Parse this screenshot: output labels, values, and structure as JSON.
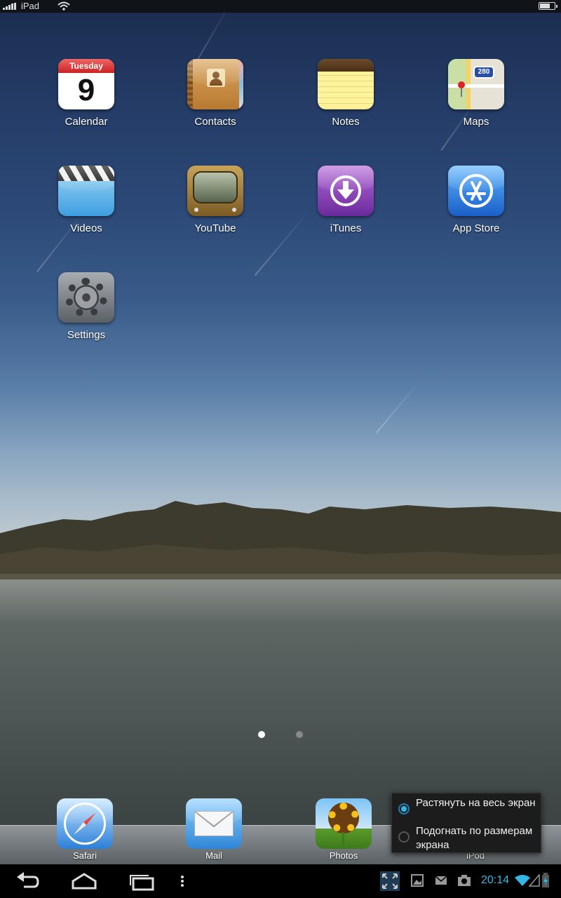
{
  "ipad_status": {
    "carrier": "iPad"
  },
  "apps": [
    {
      "label": "Calendar",
      "icon": "calendar-icon",
      "day_name": "Tuesday",
      "day_number": "9"
    },
    {
      "label": "Contacts",
      "icon": "contacts-icon"
    },
    {
      "label": "Notes",
      "icon": "notes-icon"
    },
    {
      "label": "Maps",
      "icon": "maps-icon",
      "route": "280"
    },
    {
      "label": "Videos",
      "icon": "videos-icon"
    },
    {
      "label": "YouTube",
      "icon": "youtube-icon"
    },
    {
      "label": "iTunes",
      "icon": "itunes-icon"
    },
    {
      "label": "App Store",
      "icon": "app-store-icon"
    },
    {
      "label": "Settings",
      "icon": "settings-icon"
    }
  ],
  "page_indicator": {
    "pages": 2,
    "current": 1
  },
  "dock": [
    {
      "label": "Safari",
      "icon": "safari-icon"
    },
    {
      "label": "Mail",
      "icon": "mail-icon"
    },
    {
      "label": "Photos",
      "icon": "photos-icon"
    },
    {
      "label": "iPod",
      "icon": "ipod-icon"
    }
  ],
  "display_mode_popup": {
    "options": [
      {
        "label": "Растянуть на весь экран",
        "selected": true
      },
      {
        "label": "Подогнать по размерам экрана",
        "selected": false
      }
    ]
  },
  "android_navbar": {
    "clock": "20:14",
    "accent_color": "#33b5e5",
    "buttons": [
      "back-icon",
      "home-icon",
      "recent-apps-icon",
      "menu-icon"
    ],
    "status_icons": [
      "screen-compat-icon",
      "gallery-icon",
      "email-icon",
      "camera-icon",
      "wifi-icon",
      "cell-signal-icon",
      "battery-charging-icon"
    ]
  }
}
